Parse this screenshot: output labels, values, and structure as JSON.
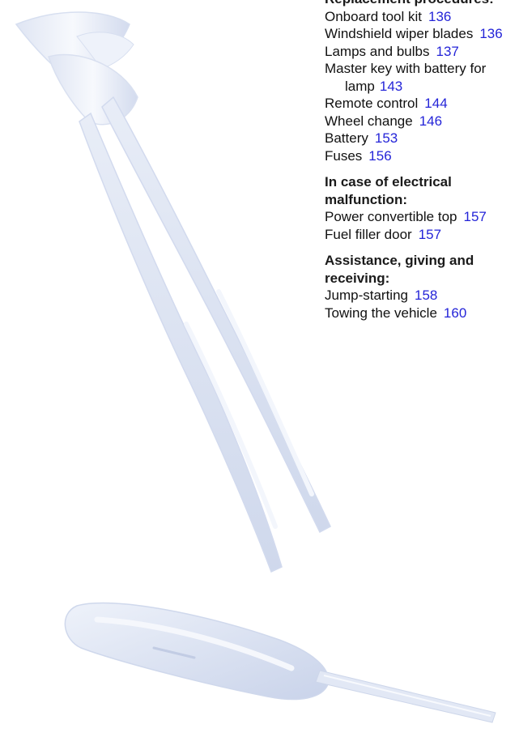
{
  "sections": [
    {
      "heading": "Replacement procedures:",
      "entries": [
        {
          "label": "Onboard tool kit",
          "page": "136"
        },
        {
          "label": "Windshield wiper blades",
          "page": "136"
        },
        {
          "label": "Lamps and bulbs",
          "page": "137"
        },
        {
          "label": "Master key with battery for",
          "page": ""
        },
        {
          "label": "lamp",
          "page": "143"
        },
        {
          "label": "Remote control",
          "page": "144"
        },
        {
          "label": "Wheel change",
          "page": "146"
        },
        {
          "label": "Battery",
          "page": "153"
        },
        {
          "label": "Fuses",
          "page": "156"
        }
      ]
    },
    {
      "heading_line1": "In case of electrical",
      "heading_line2": "malfunction:",
      "entries": [
        {
          "label": "Power convertible top",
          "page": "157"
        },
        {
          "label": "Fuel filler door",
          "page": "157"
        }
      ]
    },
    {
      "heading_line1": "Assistance, giving and",
      "heading_line2": "receiving:",
      "entries": [
        {
          "label": "Jump-starting",
          "page": "158"
        },
        {
          "label": "Towing the vehicle",
          "page": "160"
        }
      ]
    }
  ]
}
